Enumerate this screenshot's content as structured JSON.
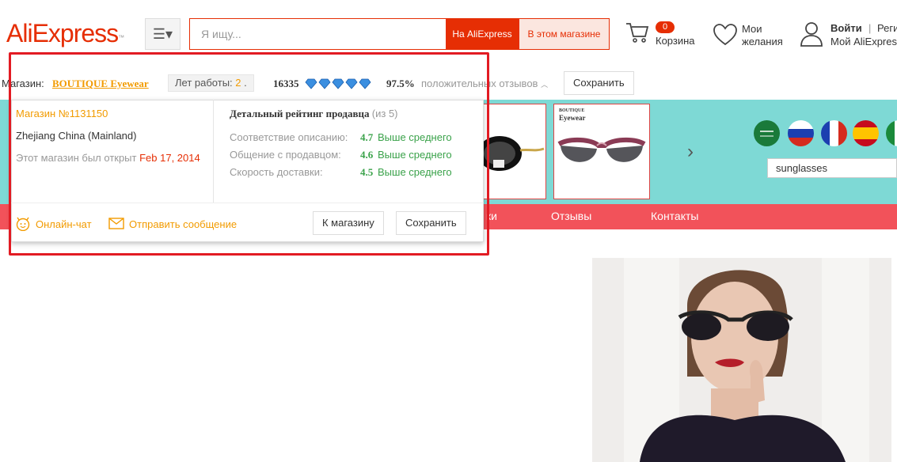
{
  "header": {
    "logo_ali": "Ali",
    "logo_express": "Express",
    "logo_tm": "™",
    "search_placeholder": "Я ищу...",
    "search_btn_ali": "На AliExpress",
    "search_btn_store": "В этом магазине",
    "cart_count": "0",
    "cart_label": "Корзина",
    "wish_line1": "Мои",
    "wish_line2": "желания",
    "signin": "Войти",
    "separator": "|",
    "register": "Регистрация",
    "my_ali": "Мой AliExpress"
  },
  "store_bar": {
    "shop_label": "Магазин:",
    "shop_name": "BOUTIQUE Eyewear",
    "years_label": "Лет работы:",
    "years_value": "2",
    "years_dot": ".",
    "feedback_score": "16335",
    "positive_pct": "97.5%",
    "positive_label": "положительных отзывов",
    "save_label": "Сохранить"
  },
  "popup": {
    "store_number": "Магазин №1131150",
    "region": "Zhejiang China (Mainland)",
    "opened_label": "Этот магазин был открыт",
    "opened_date": "Feb 17, 2014",
    "rating_title": "Детальный рейтинг продавца",
    "rating_scale": "(из 5)",
    "ratings": [
      {
        "label": "Соответствие описанию:",
        "value": "4.7",
        "text": "Выше среднего"
      },
      {
        "label": "Общение с продавцом:",
        "value": "4.6",
        "text": "Выше среднего"
      },
      {
        "label": "Скорость доставки:",
        "value": "4.5",
        "text": "Выше среднего"
      }
    ],
    "chat_label": "Онлайн-чат",
    "message_label": "Отправить сообщение",
    "to_store_label": "К магазину",
    "save_label": "Сохранить"
  },
  "banner": {
    "product_brand_line1": "BOUTIQUE",
    "product_brand_line2": "Eyewear",
    "keyword": "sunglasses"
  },
  "nav": {
    "partial_item": "ки",
    "reviews": "Отзывы",
    "contacts": "Контакты"
  },
  "colors": {
    "brand_red": "#e62e04",
    "orange": "#f29b00",
    "green": "#3aa24a",
    "teal": "#7ed9d5",
    "nav_red": "#f2525a",
    "highlight_box": "#e21b23"
  }
}
